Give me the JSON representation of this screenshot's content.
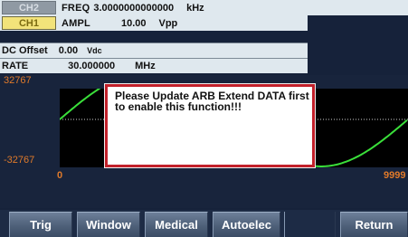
{
  "channels": {
    "ch2_label": "CH2",
    "ch1_label": "CH1"
  },
  "params": {
    "freq": {
      "label": "FREQ",
      "value": "3.0000000000000",
      "unit": "kHz"
    },
    "ampl": {
      "label": "AMPL",
      "value": "10.00",
      "unit": "Vpp"
    },
    "dc_offset": {
      "label": "DC Offset",
      "value": "0.00",
      "unit": "Vdc"
    },
    "rate": {
      "label": "RATE",
      "value": "30.000000",
      "unit": "MHz"
    }
  },
  "waveform": {
    "y_max": "32767",
    "y_min": "-32767",
    "x_start": "0",
    "x_end": "9999",
    "trace_color": "#3adf3a"
  },
  "dialog": {
    "message": "Please Update ARB Extend DATA first\nto enable this function!!!"
  },
  "softkeys": [
    {
      "label": "Trig"
    },
    {
      "label": "Window"
    },
    {
      "label": "Medical"
    },
    {
      "label": "Autoelec"
    },
    {
      "label": ""
    },
    {
      "label": "Return"
    }
  ]
}
